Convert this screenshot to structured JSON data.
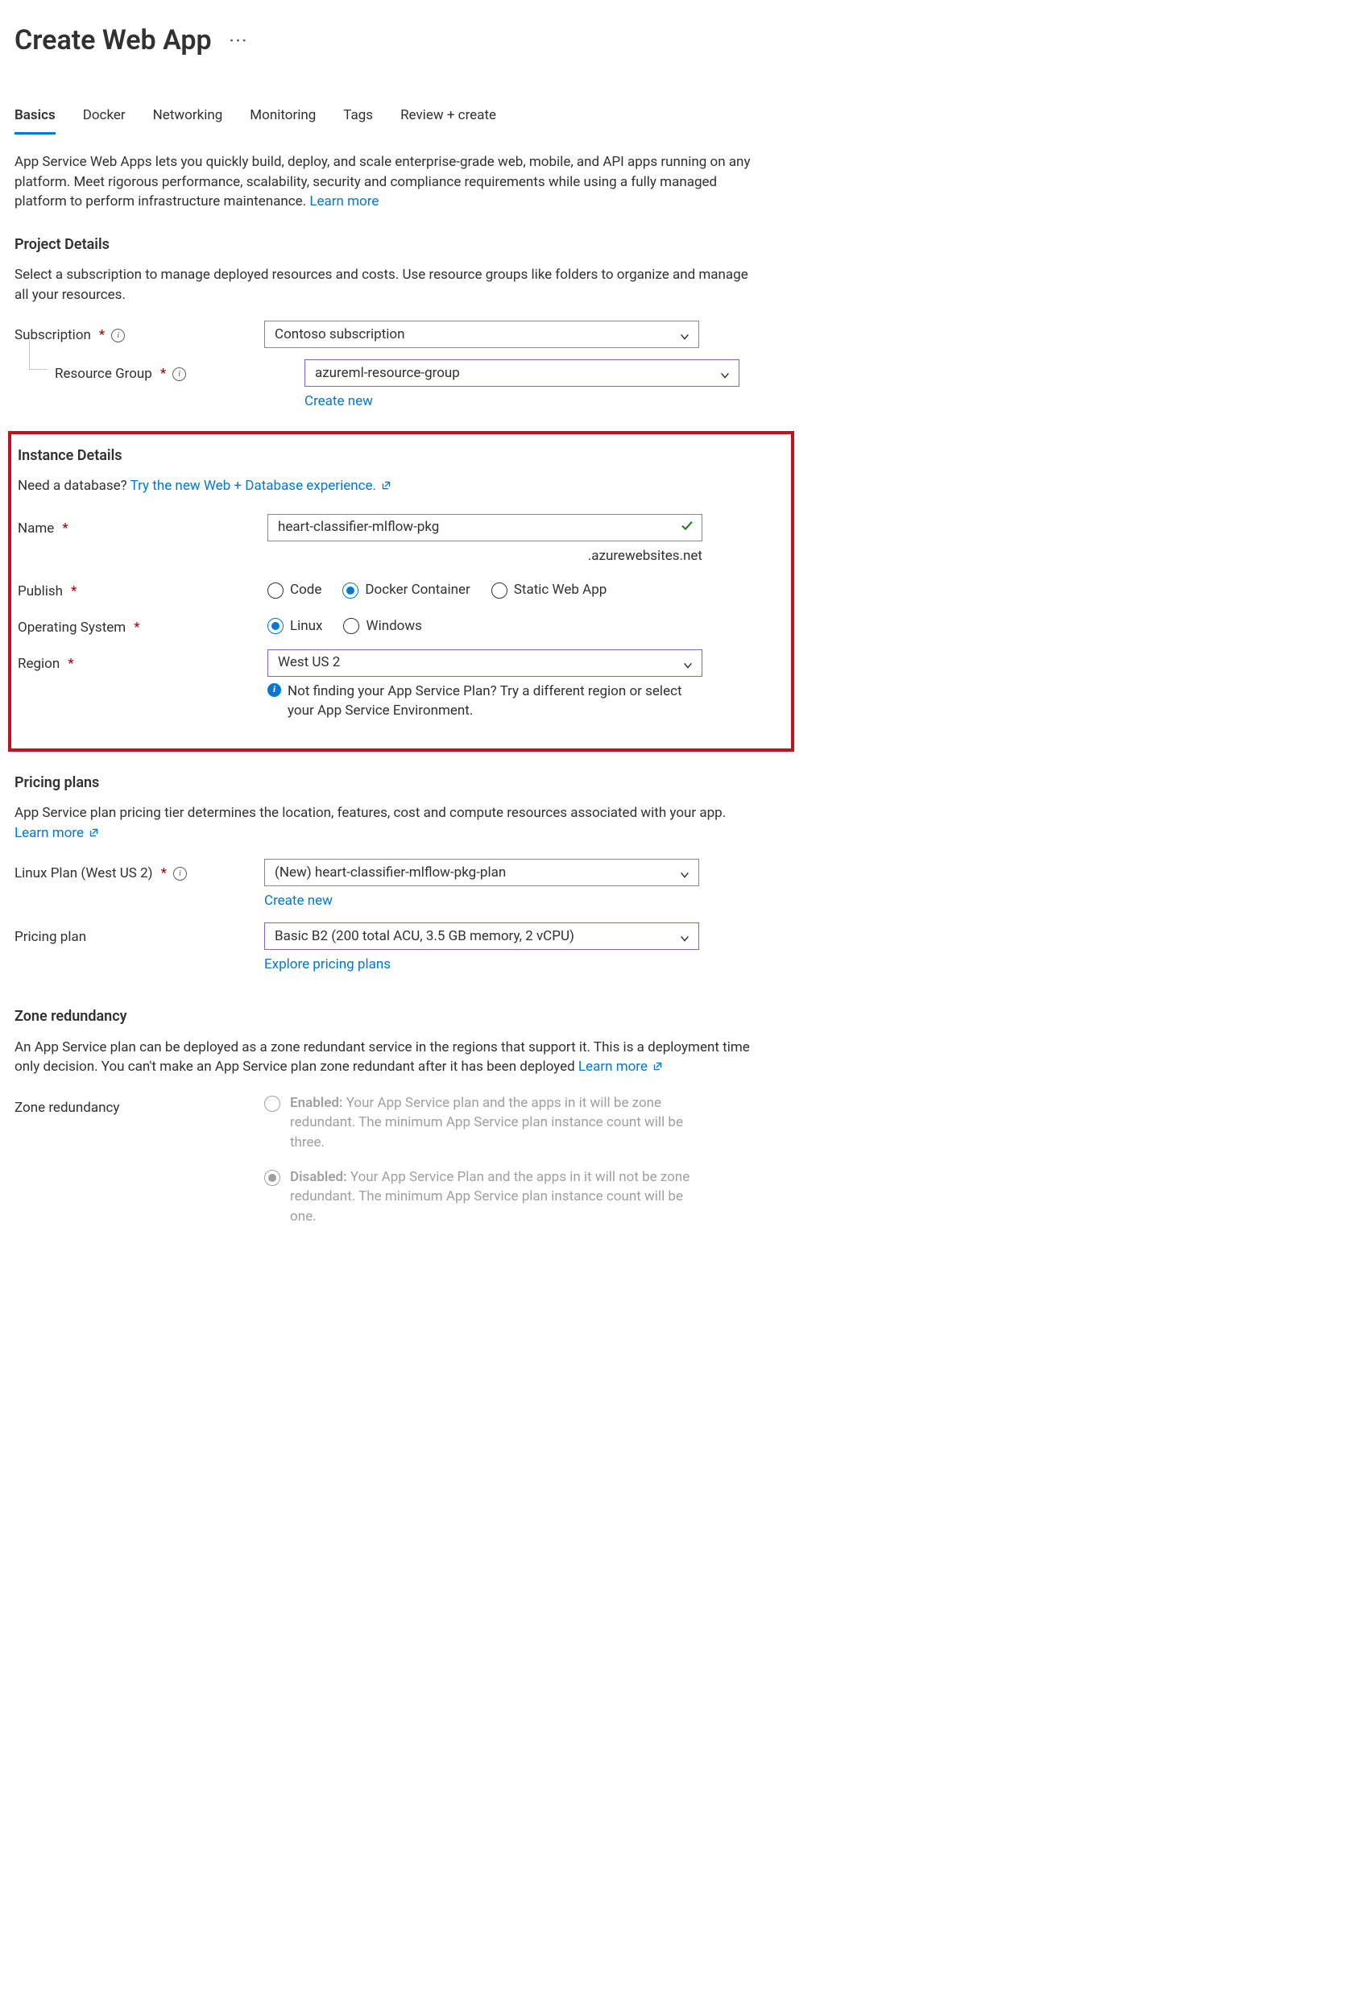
{
  "header": {
    "title": "Create Web App"
  },
  "tabs": {
    "basics": "Basics",
    "docker": "Docker",
    "networking": "Networking",
    "monitoring": "Monitoring",
    "tags": "Tags",
    "review": "Review + create"
  },
  "intro": {
    "text": "App Service Web Apps lets you quickly build, deploy, and scale enterprise-grade web, mobile, and API apps running on any platform. Meet rigorous performance, scalability, security and compliance requirements while using a fully managed platform to perform infrastructure maintenance.  ",
    "learn_more": "Learn more"
  },
  "project": {
    "heading": "Project Details",
    "desc": "Select a subscription to manage deployed resources and costs. Use resource groups like folders to organize and manage all your resources.",
    "subscription_label": "Subscription",
    "subscription_value": "Contoso subscription",
    "rg_label": "Resource Group",
    "rg_value": "azureml-resource-group",
    "create_new": "Create new"
  },
  "instance": {
    "heading": "Instance Details",
    "db_prompt": "Need a database? ",
    "db_link": "Try the new Web + Database experience.",
    "name_label": "Name",
    "name_value": "heart-classifier-mlflow-pkg",
    "name_suffix": ".azurewebsites.net",
    "publish_label": "Publish",
    "publish_options": {
      "code": "Code",
      "docker": "Docker Container",
      "static": "Static Web App"
    },
    "os_label": "Operating System",
    "os_options": {
      "linux": "Linux",
      "windows": "Windows"
    },
    "region_label": "Region",
    "region_value": "West US 2",
    "region_hint": "Not finding your App Service Plan? Try a different region or select your App Service Environment."
  },
  "pricing": {
    "heading": "Pricing plans",
    "desc": "App Service plan pricing tier determines the location, features, cost and compute resources associated with your app.",
    "learn_more": "Learn more",
    "plan_label": "Linux Plan (West US 2)",
    "plan_value": "(New) heart-classifier-mlflow-pkg-plan",
    "create_new": "Create new",
    "tier_label": "Pricing plan",
    "tier_value": "Basic B2 (200 total ACU, 3.5 GB memory, 2 vCPU)",
    "explore": "Explore pricing plans"
  },
  "zone": {
    "heading": "Zone redundancy",
    "desc": "An App Service plan can be deployed as a zone redundant service in the regions that support it. This is a deployment time only decision. You can't make an App Service plan zone redundant after it has been deployed ",
    "learn_more": "Learn more",
    "label": "Zone redundancy",
    "enabled_title": "Enabled:",
    "enabled_desc": " Your App Service plan and the apps in it will be zone redundant. The minimum App Service plan instance count will be three.",
    "disabled_title": "Disabled:",
    "disabled_desc": " Your App Service Plan and the apps in it will not be zone redundant. The minimum App Service plan instance count will be one."
  }
}
